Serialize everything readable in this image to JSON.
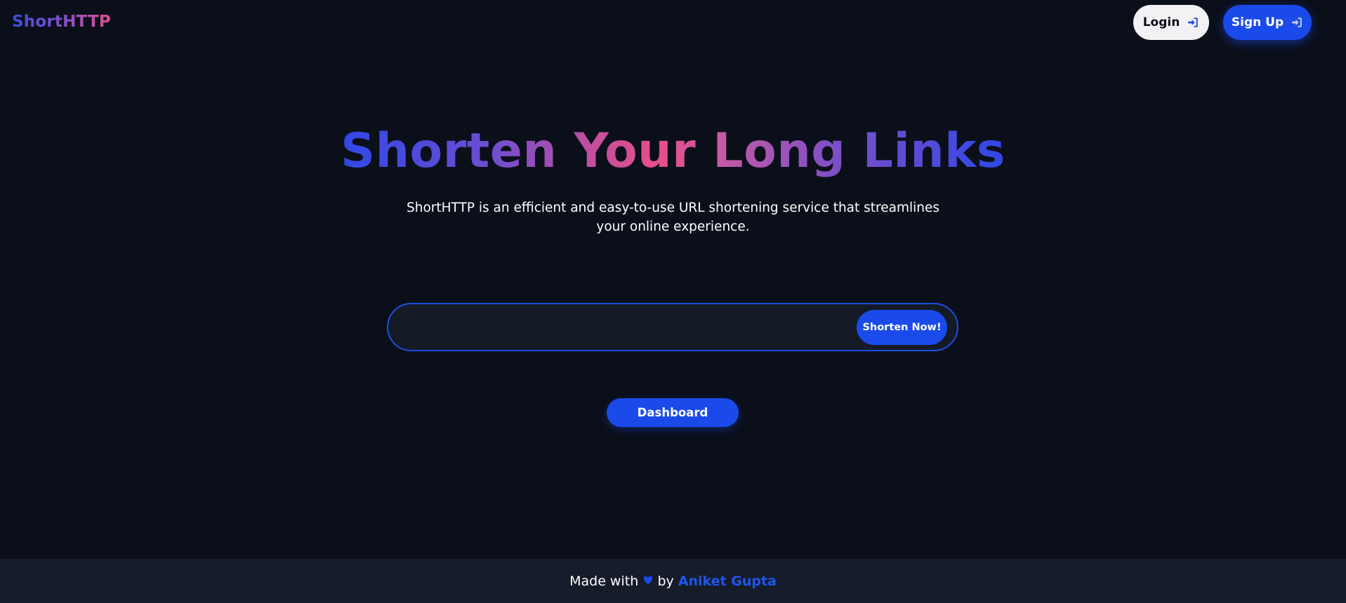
{
  "header": {
    "brand": "ShortHTTP",
    "login_label": "Login",
    "signup_label": "Sign Up",
    "login_icon": "sign-in-icon",
    "signup_icon": "sign-in-icon"
  },
  "hero": {
    "title": "Shorten Your Long Links",
    "subtitle": "ShortHTTP is an efficient and easy-to-use URL shortening service that streamlines your online experience."
  },
  "shortener": {
    "input_value": "",
    "input_placeholder": "",
    "button_label": "Shorten Now!"
  },
  "dashboard": {
    "label": "Dashboard"
  },
  "footer": {
    "prefix": "Made with",
    "heart": "♥",
    "by": "by",
    "author": "Aniket Gupta"
  },
  "colors": {
    "background": "#0b0f1a",
    "accent": "#1a4bea",
    "footer_bg": "#161c29",
    "gradient_start": "#2f47e6",
    "gradient_mid": "#e84f88"
  }
}
